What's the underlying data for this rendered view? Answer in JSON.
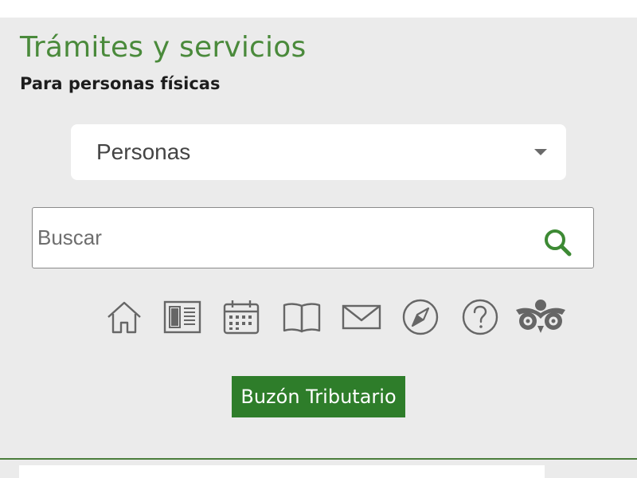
{
  "header": {
    "title": "Trámites y servicios",
    "subtitle": "Para personas físicas"
  },
  "audience_select": {
    "selected": "Personas"
  },
  "search": {
    "placeholder": "Buscar",
    "value": "",
    "button_icon": "search-icon"
  },
  "nav_icons": [
    {
      "name": "home-icon"
    },
    {
      "name": "news-icon"
    },
    {
      "name": "calendar-icon"
    },
    {
      "name": "book-icon"
    },
    {
      "name": "mail-icon"
    },
    {
      "name": "compass-icon"
    },
    {
      "name": "help-icon"
    },
    {
      "name": "owl-icon"
    }
  ],
  "cta": {
    "label": "Buzón Tributario"
  },
  "colors": {
    "brand_green": "#4a8a3b",
    "button_green": "#2e7d2a",
    "panel_bg": "#ebebeb",
    "icon_gray": "#666666"
  }
}
